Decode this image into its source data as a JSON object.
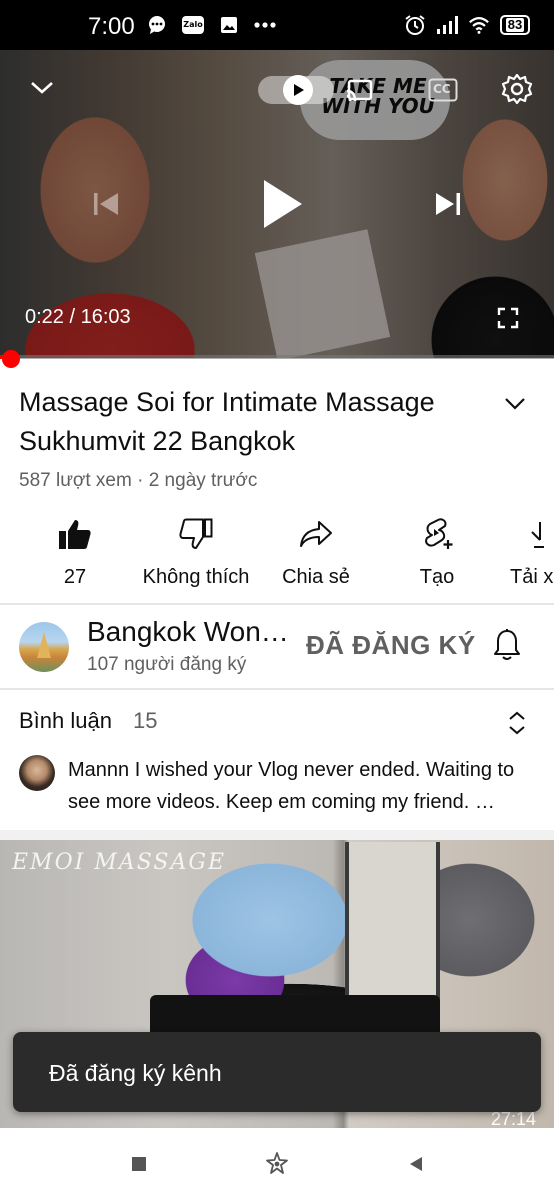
{
  "status_bar": {
    "time": "7:00",
    "left_icons": [
      "chat-bubble-icon",
      "zalo-icon",
      "gallery-icon",
      "more-dots-icon"
    ],
    "zalo_label": "Zalo",
    "right_icons": [
      "alarm-icon",
      "signal-icon",
      "wifi-icon",
      "battery-icon"
    ],
    "battery_level": "83"
  },
  "player": {
    "current_time": "0:22",
    "separator": " / ",
    "duration": "16:03",
    "time_readout": "0:22 / 16:03",
    "progress": 0.023,
    "overlay_text": "TAKE ME WITH YOU",
    "cc_label": "CC",
    "accent": "#ff0000"
  },
  "video": {
    "title": "Massage Soi for Intimate Massage Sukhumvit 22 Bangkok",
    "meta": "587 lượt xem · 2 ngày trước"
  },
  "actions": {
    "like": "27",
    "dislike": "Không thích",
    "share": "Chia sẻ",
    "create": "Tạo",
    "download": "Tải x"
  },
  "channel": {
    "name": "Bangkok Won…",
    "subscribers": "107 người đăng ký",
    "subscribe_state": "ĐÃ ĐĂNG KÝ"
  },
  "comments": {
    "title": "Bình luận",
    "count": "15",
    "top_comment": "Mannn I wished your Vlog never ended. Waiting to see more videos. Keep em coming my friend. …"
  },
  "next_video": {
    "logo_text": "EMOI MASSAGE",
    "duration": "27:14"
  },
  "toast": {
    "message": "Đã đăng ký kênh"
  },
  "navbar": {
    "icons": [
      "recents-square-icon",
      "home-star-icon",
      "back-triangle-icon"
    ]
  }
}
